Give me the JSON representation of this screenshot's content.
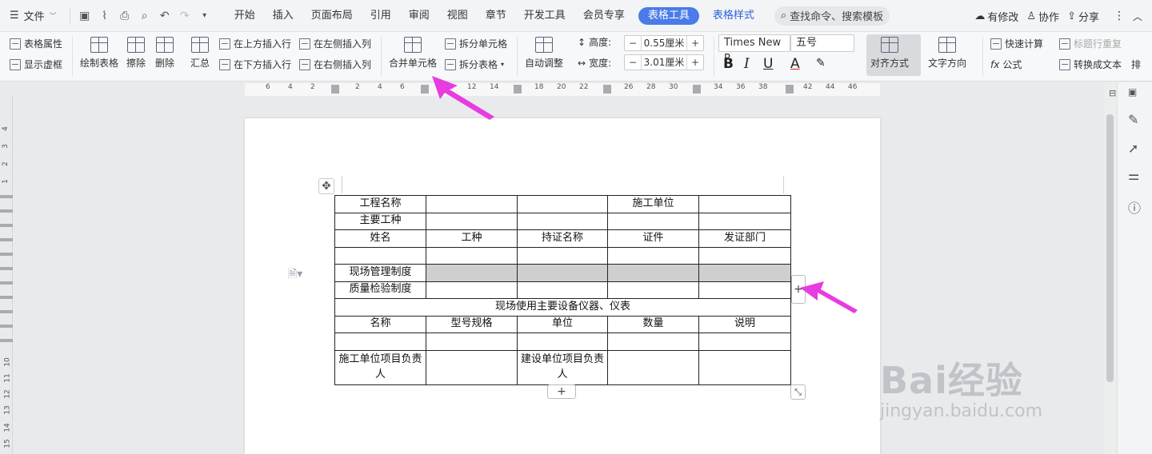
{
  "menubar": {
    "file_label": "文件",
    "tabs": [
      "开始",
      "插入",
      "页面布局",
      "引用",
      "审阅",
      "视图",
      "章节",
      "开发工具",
      "会员专享"
    ],
    "active_tab": "表格工具",
    "styles_tab": "表格样式",
    "search_placeholder": "查找命令、搜索模板",
    "modified": "有修改",
    "collab": "协作",
    "share": "分享"
  },
  "ribbon": {
    "table_props": "表格属性",
    "show_gridlines": "显示虚框",
    "draw_table": "绘制表格",
    "erase": "擦除",
    "delete": "删除",
    "summary": "汇总",
    "insert_above": "在上方插入行",
    "insert_below": "在下方插入行",
    "insert_left": "在左侧插入列",
    "insert_right": "在右侧插入列",
    "merge_cells": "合并单元格",
    "split_cells": "拆分单元格",
    "split_table": "拆分表格",
    "auto_fit": "自动调整",
    "height_label": "高度:",
    "height_value": "0.55厘米",
    "width_label": "宽度:",
    "width_value": "3.01厘米",
    "font_name": "Times New R",
    "font_size": "五号",
    "bold": "B",
    "italic": "I",
    "underline": "U",
    "font_color": "A",
    "align": "对齐方式",
    "text_dir": "文字方向",
    "quick_calc": "快速计算",
    "repeat_header": "标题行重复",
    "formula": "公式",
    "convert_text": "转换成文本",
    "more": "排"
  },
  "ruler": {
    "ticks": [
      "6",
      "4",
      "2",
      "2",
      "4",
      "6",
      "10",
      "12",
      "14",
      "18",
      "20",
      "22",
      "26",
      "28",
      "30",
      "34",
      "36",
      "38",
      "42",
      "44",
      "46"
    ],
    "vticks": [
      "4",
      "3",
      "2",
      "1",
      "10",
      "11",
      "12",
      "13",
      "14",
      "15"
    ]
  },
  "table": {
    "r1": [
      "工程名称",
      "",
      "",
      "施工单位",
      ""
    ],
    "r2": [
      "主要工种",
      "",
      "",
      "",
      ""
    ],
    "r3": [
      "姓名",
      "工种",
      "持证名称",
      "证件",
      "发证部门"
    ],
    "r4": [
      "",
      "",
      "",
      "",
      ""
    ],
    "r5": [
      "现场管理制度",
      "",
      "",
      "",
      ""
    ],
    "r6": [
      "质量检验制度",
      "",
      "",
      "",
      ""
    ],
    "r7": "现场使用主要设备仪器、仪表",
    "r8": [
      "名称",
      "型号规格",
      "单位",
      "数量",
      "说明"
    ],
    "r9": [
      "",
      "",
      "",
      "",
      ""
    ],
    "r10": [
      "施工单位项目负责人",
      "",
      "建设单位项目负责人",
      "",
      ""
    ]
  },
  "watermark": {
    "brand": "Bai经验",
    "url": "jingyan.baidu.com"
  },
  "colors": {
    "accent": "#4a7be8",
    "arrow": "#e83be0",
    "shade": "#cfcfcf"
  }
}
